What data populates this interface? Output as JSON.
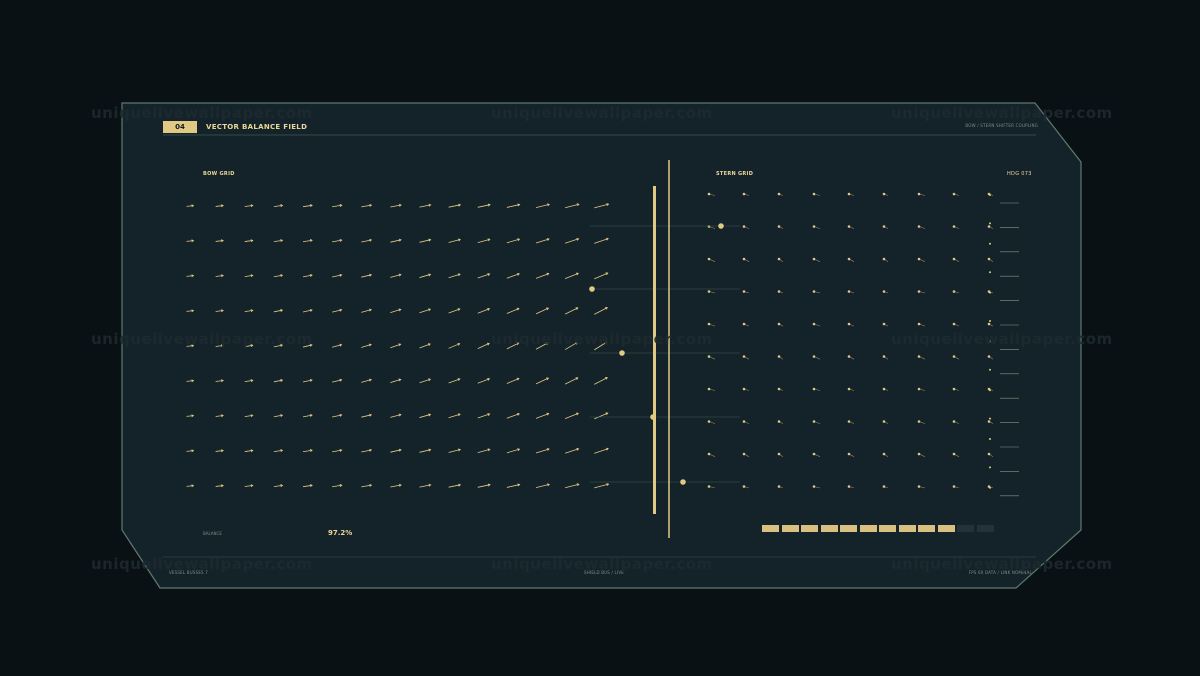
{
  "header": {
    "badge": "04",
    "title": "VECTOR BALANCE FIELD",
    "right_text": "BOW / STERN SHIFTER COUPLING"
  },
  "bow_grid": {
    "title": "BOW GRID",
    "cols": 15,
    "rows": 9
  },
  "stern_grid": {
    "title": "STERN GRID",
    "code": "HDG 073",
    "cols": 9,
    "rows": 10
  },
  "balance": {
    "label": "BALANCE",
    "value": "97.2%"
  },
  "level_meter": {
    "segments": 12,
    "filled": 10
  },
  "footer": {
    "left": "VESSEL BUSSES 7",
    "center": "SHIELD BUS / LIVE",
    "right": "FPS 60 DATA / LINK NOMINAL"
  },
  "watermark": "uniquelivewallpaper.com",
  "colors": {
    "panel_bg": "#14232a",
    "panel_border": "#5e7a6c",
    "accent": "#e2c983",
    "text_dim": "#7f8b87"
  }
}
